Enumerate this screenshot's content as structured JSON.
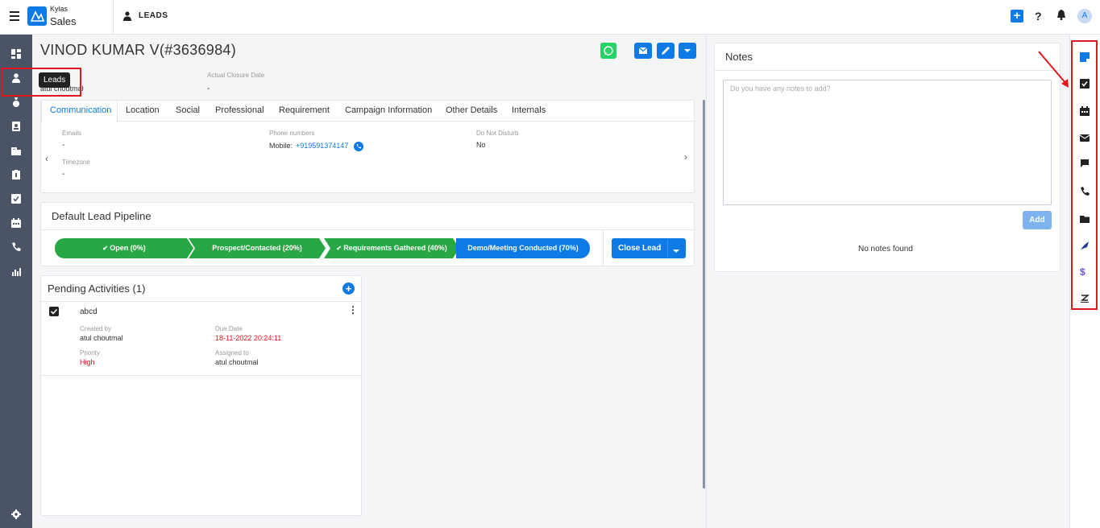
{
  "app": {
    "brand_top": "Kylas",
    "brand_bottom": "Sales",
    "page_label": "LEADS",
    "avatar_letter": "A",
    "help": "?",
    "plus": "+"
  },
  "tooltip": "Leads",
  "lead": {
    "name": "VINOD KUMAR V(#3636984)",
    "owner_fragment": "atul choutmal",
    "actual_closure_label": "Actual Closure Date",
    "actual_closure_value": "-"
  },
  "tabs": [
    "Communication",
    "Location",
    "Social",
    "Professional",
    "Requirement",
    "Campaign Information",
    "Other Details",
    "Internals"
  ],
  "communication": {
    "emails_label": "Emails",
    "emails_value": "-",
    "phone_label": "Phone numbers",
    "phone_prefix": "Mobile:",
    "phone_value": "+919591374147",
    "dnd_label": "Do Not Disturb",
    "dnd_value": "No",
    "tz_label": "Timezone",
    "tz_value": "-"
  },
  "pipeline": {
    "title": "Default Lead Pipeline",
    "stages": [
      {
        "label": "Open (0%)",
        "check": true,
        "color": "#28a745"
      },
      {
        "label": "Prospect/Contacted (20%)",
        "check": false,
        "color": "#28a745"
      },
      {
        "label": "Requirements Gathered (40%)",
        "check": true,
        "color": "#28a745"
      },
      {
        "label": "Demo/Meeting Conducted (70%)",
        "check": false,
        "color": "#0e7ae6"
      }
    ],
    "close_label": "Close Lead"
  },
  "pending": {
    "title": "Pending Activities (1)",
    "activity": {
      "name": "abcd",
      "created_by_label": "Created by",
      "created_by": "atul choutmal",
      "due_label": "Due Date",
      "due": "18-11-2022 20:24:11",
      "priority_label": "Priority",
      "priority": "High",
      "assigned_label": "Assigned to",
      "assigned": "atul choutmal"
    }
  },
  "notes": {
    "title": "Notes",
    "placeholder": "Do you have any notes to add?",
    "add_label": "Add",
    "empty": "No notes found"
  },
  "colors": {
    "accent": "#0e7ae6",
    "sidebar": "#4a5466",
    "whatsapp": "#26d367",
    "danger": "#e0171c",
    "success": "#28a745"
  }
}
